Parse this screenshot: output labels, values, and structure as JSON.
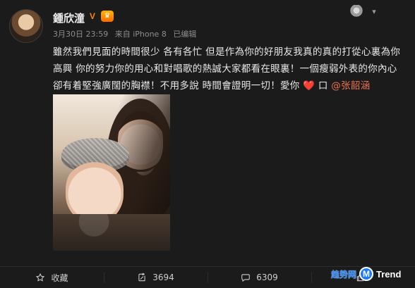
{
  "post": {
    "username": "鍾欣潼",
    "badges": {
      "verified_label": "V",
      "vip_label": "♛"
    },
    "meta": {
      "date": "3月30日 23:59",
      "source": "来自 iPhone 8",
      "edited": "已编辑"
    },
    "text_line1": "雖然我們見面的時間很少 各有各忙 但是作為你的好朋友我真的真的打從心裏為你",
    "text_line2": "高興 你的努力你的用心和對唱歌的熱誠大家都看在眼裏！一個瘦弱外表的你內心",
    "text_line3_prefix": "卻有着堅強廣闊的胸襟！不用多說 時間會證明一切！愛你",
    "heart_symbol": "❤️",
    "text_line3_after_heart": "口",
    "mention": "@张韶涵"
  },
  "actions": {
    "favorite_label": "收藏",
    "repost_count": "3694",
    "comment_count": "6309",
    "like_count": ""
  },
  "watermark": {
    "zh": "趋势网",
    "circle": "M",
    "en": "Trend"
  },
  "colors": {
    "background": "#1b1b1b",
    "accent_orange": "#ff8200",
    "mention": "#eb7350",
    "heart": "#ff3b3b"
  },
  "icons": {
    "favorite": "star-icon",
    "repost": "repost-icon",
    "comment": "comment-icon",
    "like": "thumbs-up-icon",
    "menu": "chevron-down-icon"
  }
}
